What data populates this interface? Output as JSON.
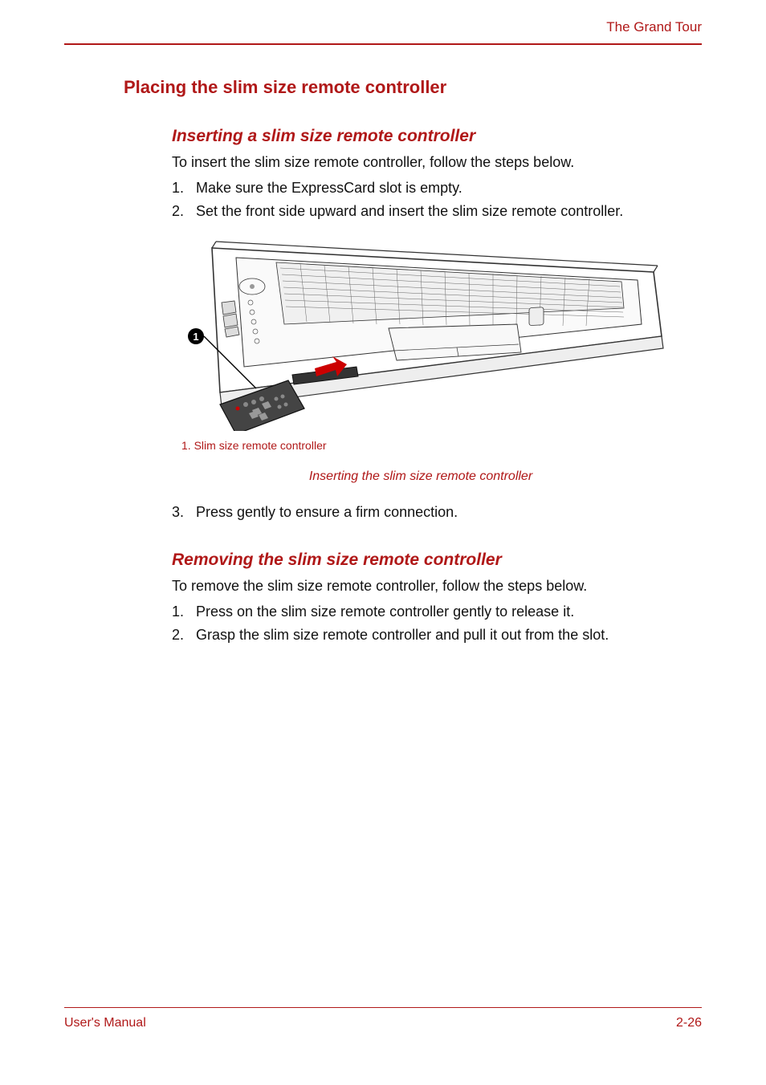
{
  "header": {
    "chapter_title": "The Grand Tour"
  },
  "section": {
    "heading": "Placing the slim size remote controller"
  },
  "inserting": {
    "heading": "Inserting a slim size remote controller",
    "intro": "To insert the slim size remote controller, follow the steps below.",
    "steps": {
      "s1": "Make sure the ExpressCard slot is empty.",
      "s2": "Set the front side upward and insert the slim size remote controller.",
      "s3": "Press gently to ensure a firm connection."
    }
  },
  "figure": {
    "callout_number": "1.",
    "callout_text": "Slim size remote controller",
    "caption": "Inserting the slim size remote controller"
  },
  "removing": {
    "heading": "Removing the slim size remote controller",
    "intro": "To remove the slim size remote controller, follow the steps below.",
    "steps": {
      "s1": "Press on the slim size remote controller gently to release it.",
      "s2": "Grasp the slim size remote controller and pull it out from the slot."
    }
  },
  "footer": {
    "left": "User's Manual",
    "right": "2-26"
  },
  "list_numbers": {
    "n1": "1.",
    "n2": "2.",
    "n3": "3."
  }
}
